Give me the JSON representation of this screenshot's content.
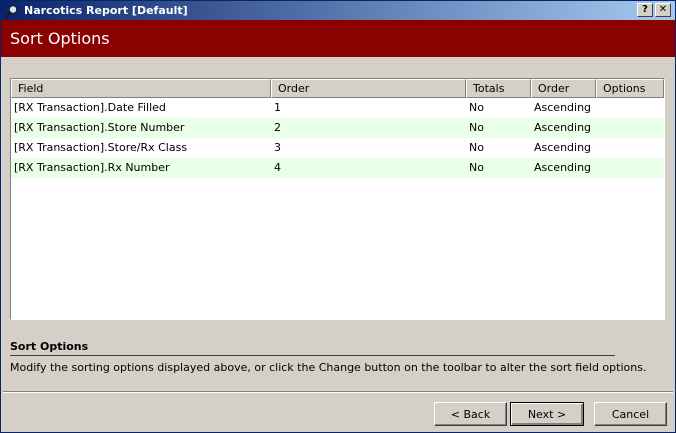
{
  "window": {
    "title": "Narcotics Report [Default]",
    "help_label": "?",
    "close_label": "✕"
  },
  "banner": {
    "title": "Sort Options"
  },
  "grid": {
    "columns": [
      "Field",
      "Order",
      "Totals",
      "Order",
      "Options"
    ],
    "rows": [
      {
        "field": "[RX Transaction].Date Filled",
        "order": "1",
        "totals": "No",
        "direction": "Ascending",
        "options": ""
      },
      {
        "field": "[RX Transaction].Store Number",
        "order": "2",
        "totals": "No",
        "direction": "Ascending",
        "options": ""
      },
      {
        "field": "[RX Transaction].Store/Rx Class",
        "order": "3",
        "totals": "No",
        "direction": "Ascending",
        "options": ""
      },
      {
        "field": "[RX Transaction].Rx Number",
        "order": "4",
        "totals": "No",
        "direction": "Ascending",
        "options": ""
      }
    ]
  },
  "info": {
    "title": "Sort Options",
    "description": "Modify the sorting options displayed above, or click the Change button on the toolbar to alter the sort field options."
  },
  "buttons": {
    "back": "< Back",
    "next": "Next >",
    "cancel": "Cancel"
  },
  "colors": {
    "banner": "#8b0000",
    "titlebar_start": "#0a246a",
    "titlebar_end": "#a6caf0",
    "alt_row": "#e8ffe8"
  },
  "icons": {
    "app": "magnifier-icon"
  }
}
